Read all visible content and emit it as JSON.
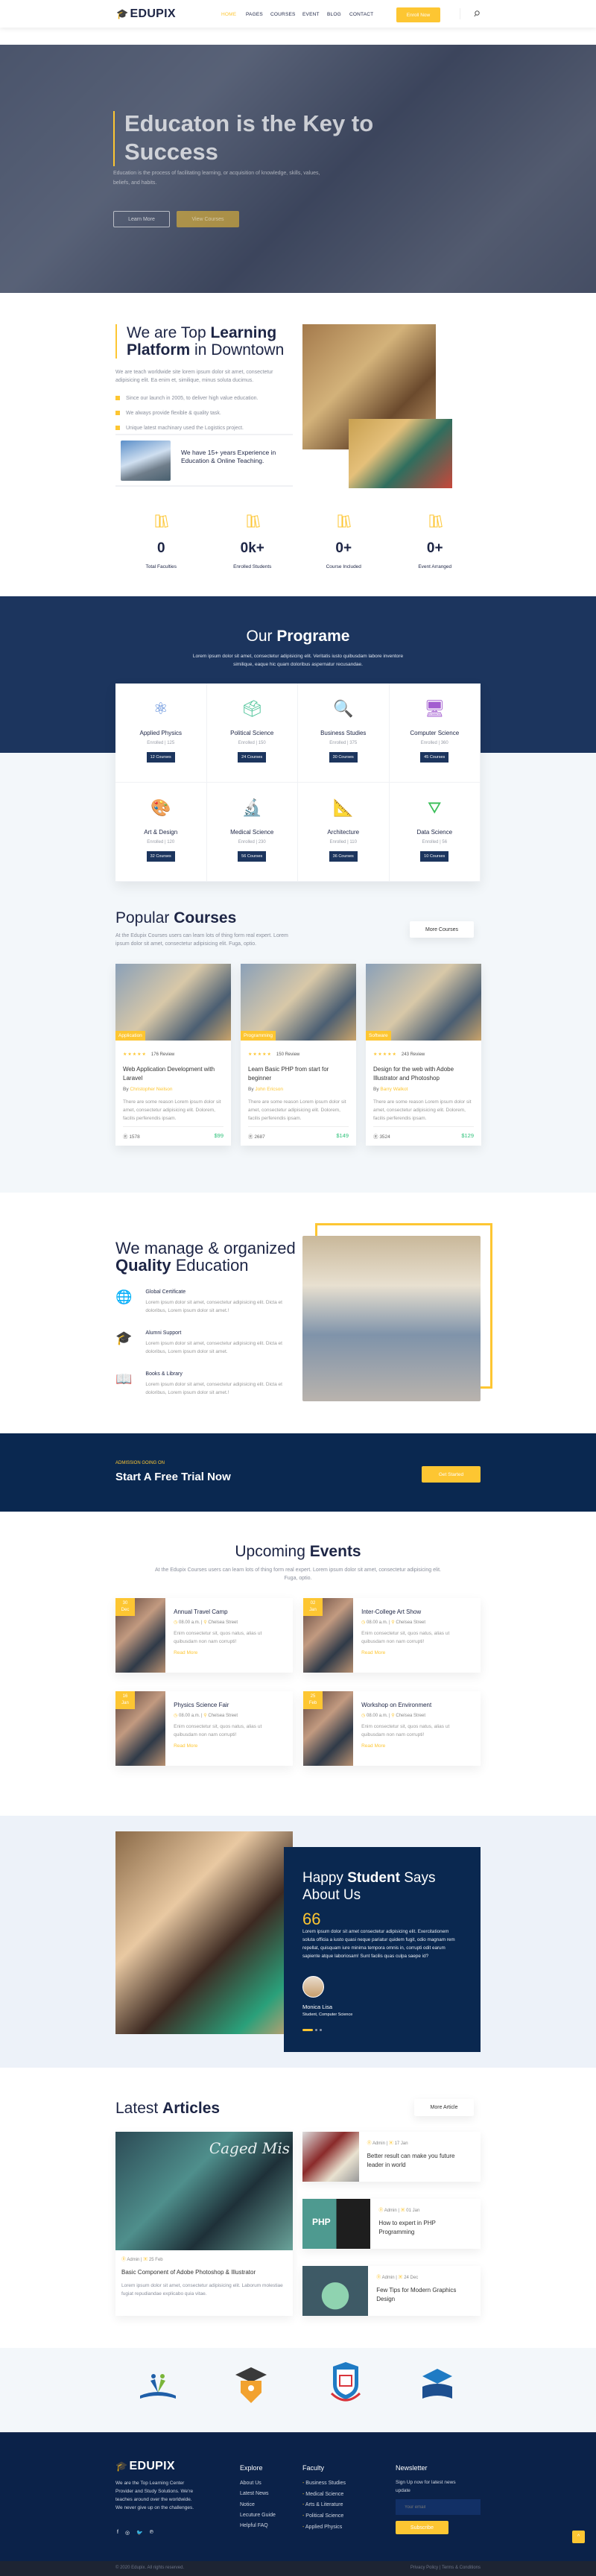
{
  "colors": {
    "accent": "#fdc632",
    "navy": "#1c355e",
    "dark_navy": "#0a2850",
    "price": "#2fc27b"
  },
  "header": {
    "logo": "EDUPIX",
    "nav": [
      {
        "label": "HOME",
        "active": true
      },
      {
        "label": "PAGES"
      },
      {
        "label": "COURSES"
      },
      {
        "label": "EVENT"
      },
      {
        "label": "BLOG"
      },
      {
        "label": "CONTACT"
      }
    ],
    "cta": "Enroll Now",
    "search_icon": "search-icon"
  },
  "hero": {
    "title": "Educaton is the Key to Success",
    "subtitle": "Education is the process of facilitating learning, or acquisition of knowledge, skills, values, beliefs, and habits.",
    "learn_more": "Learn More",
    "view_courses": "View Courses"
  },
  "about": {
    "title_pre": "We are Top ",
    "title_bold1": "Learning",
    "title_bold2": "Platform",
    "title_post": " in Downtown",
    "text": "We are teach worldwide site lorem ipsum dolor sit amet, consectetur adipisicing elit. Ea enim et, similique, minus soluta ducimus.",
    "bullets": [
      "Since our launch in 2005, to deliver high value education.",
      "We always provide flexible & quality task.",
      "Unique latest machinary used the Logistics project."
    ],
    "experience": "We have 15+ years Experience in Education & Online Teaching."
  },
  "stats": [
    {
      "icon": "books-icon",
      "value": "0",
      "label": "Total Faculties"
    },
    {
      "icon": "student-icon",
      "value": "0k+",
      "label": "Enrolled Students"
    },
    {
      "icon": "presentation-icon",
      "value": "0+",
      "label": "Course Included"
    },
    {
      "icon": "clipboard-icon",
      "value": "0+",
      "label": "Event Arranged"
    }
  ],
  "programs": {
    "title_pre": "Our ",
    "title_bold": "Programe",
    "text": "Lorem ipsum dolor sit amet, consectetur adipisicing elit. Veritatis iusto quibusdam labore inventore similique, eaque hic quam doloribus aspernatur recusandae.",
    "items": [
      {
        "icon": "⚛",
        "color": "#4a7fd6",
        "name": "Applied Physics",
        "enrolled": "Enrolled | 125",
        "courses": "12 Courses"
      },
      {
        "icon": "🗳",
        "color": "#4fc49a",
        "name": "Political Science",
        "enrolled": "Enrolled | 150",
        "courses": "24 Courses"
      },
      {
        "icon": "🔍",
        "color": "#e8625c",
        "name": "Business Studies",
        "enrolled": "Enrolled | 375",
        "courses": "30 Courses"
      },
      {
        "icon": "🖥",
        "color": "#a35ed0",
        "name": "Computer Science",
        "enrolled": "Enrolled | 360",
        "courses": "45 Courses"
      },
      {
        "icon": "🎨",
        "color": "#f5b93a",
        "name": "Art & Design",
        "enrolled": "Enrolled | 120",
        "courses": "32 Courses"
      },
      {
        "icon": "🔬",
        "color": "#3cc7d6",
        "name": "Medical Science",
        "enrolled": "Enrolled | 230",
        "courses": "56 Courses"
      },
      {
        "icon": "📐",
        "color": "#f0a53a",
        "name": "Architecture",
        "enrolled": "Enrolled | 110",
        "courses": "36 Courses"
      },
      {
        "icon": "⛛",
        "color": "#3bbf5a",
        "name": "Data Science",
        "enrolled": "Enrolled | 56",
        "courses": "10 Courses"
      }
    ]
  },
  "courses": {
    "title_pre": "Popular ",
    "title_bold": "Courses",
    "text": "At the Edupix Courses users can learn lots of thing form real expert. Lorem ipsum dolor sit amet, consectetur adipisicing elit. Fuga, optio.",
    "more": "More Courses",
    "items": [
      {
        "tag": "Application",
        "rating": 5,
        "reviews": "176 Review",
        "title": "Web Application Development with Laravel",
        "by": "By ",
        "author": "Christopher Neilson",
        "desc": "There are some reason Lorem ipsum dolor sit amet, consectetur adipisicing elit. Dolorem, facilis perferendis ipsam.",
        "students": "1578",
        "price": "$99"
      },
      {
        "tag": "Programming",
        "rating": 5,
        "reviews": "150 Review",
        "title": "Learn Basic PHP from start for beginner",
        "by": "By ",
        "author": "John Ericson",
        "desc": "There are some reason Lorem ipsum dolor sit amet, consectetur adipisicing elit. Dolorem, facilis perferendis ipsam.",
        "students": "2687",
        "price": "$149"
      },
      {
        "tag": "Software",
        "rating": 5,
        "reviews": "243 Review",
        "title": "Design for the web with Adobe Illustrator and Photoshop",
        "by": "By ",
        "author": "Barry Walkot",
        "desc": "There are some reason Lorem ipsum dolor sit amet, consectetur adipisicing elit. Dolorem, facilis perferendis ipsam.",
        "students": "3524",
        "price": "$129"
      }
    ]
  },
  "quality": {
    "title_line1": "We manage & organized",
    "title_bold": "Quality",
    "title_post": " Education",
    "features": [
      {
        "icon": "globe-icon",
        "glyph": "🌐",
        "title": "Global Certificate",
        "text": "Lorem ipsum dolor sit amet, consectetur adipisicing elit. Dicta et doloribus, Lorem ipsum dolor sit amet.!"
      },
      {
        "icon": "graduation-cap-icon",
        "glyph": "🎓",
        "title": "Alumni Support",
        "text": "Lorem ipsum dolor sit amet, consectetur adipisicing elit. Dicta et doloribus, Lorem ipsum dolor sit amet."
      },
      {
        "icon": "book-icon",
        "glyph": "📖",
        "title": "Books & Library",
        "text": "Lorem ipsum dolor sit amet, consectetur adipisicing elit. Dicta et doloribus, Lorem ipsum dolor sit amet.!"
      }
    ]
  },
  "cta": {
    "kicker": "ADMISSION GOING ON",
    "title": "Start A Free Trial Now",
    "button": "Get Started"
  },
  "events": {
    "title_pre": "Upcoming ",
    "title_bold": "Events",
    "text": "At the Edupix Courses users can learn lots of thing form real expert. Lorem ipsum dolor sit amet, consectetur adipisicing elit. Fuga, optio.",
    "items": [
      {
        "day": "30",
        "month": "Dec",
        "title": "Annual Travel Camp",
        "time": "08.00 a.m.",
        "place": "Chelsea Street",
        "desc": "Enim consectetur sit, quos natus, alias ut quibusdam non nam corrupti!",
        "link": "Read More"
      },
      {
        "day": "02",
        "month": "Jan",
        "title": "Inter-College Art Show",
        "time": "08.00 a.m.",
        "place": "Chelsea Street",
        "desc": "Enim consectetur sit, quos natus, alias ut quibusdam non nam corrupti!",
        "link": "Read More"
      },
      {
        "day": "16",
        "month": "Jan",
        "title": "Physics Science Fair",
        "time": "08.00 a.m.",
        "place": "Chelsea Street",
        "desc": "Enim consectetur sit, quos natus, alias ut quibusdam non nam corrupti!",
        "link": "Read More"
      },
      {
        "day": "25",
        "month": "Feb",
        "title": "Workshop on Environment",
        "time": "08.00 a.m.",
        "place": "Chelsea Street",
        "desc": "Enim consectetur sit, quos natus, alias ut quibusdam non nam corrupti!",
        "link": "Read More"
      }
    ]
  },
  "testimonial": {
    "title_pre": "Happy ",
    "title_bold": "Student",
    "title_post": " Says About Us",
    "quote": "Lorem ipsum dolor sit amet consectetur adipisicing elit. Exercitationem soluta officia a iusto quasi neque pariatur quidem fugit, odio magnam rem repellat, quisquam iure minima tempora omnis in, corrupti odit earum sapiente atque laboriosam! Sunt facilis quas culpa saepe id?",
    "name": "Monica Lisa",
    "role": "Student, Computer Science",
    "active_slide": 1,
    "slides": 3
  },
  "articles": {
    "title_pre": "Latest ",
    "title_bold": "Articles",
    "more": "More Article",
    "featured": {
      "author": "Admin",
      "date": "25 Feb",
      "title": "Basic Component of Adobe Photoshop & Illustrator",
      "text": "Lorem ipsum dolor sit amet, consectetur adipisicing elit. Laborum molestiae fugiat repudiandae explicabo quia vitae.",
      "image_text": "Caged Mis"
    },
    "items": [
      {
        "author": "Admin",
        "date": "17 Jan",
        "title": "Better result can make you future leader in world"
      },
      {
        "author": "Admin",
        "date": "01 Jan",
        "title": "How to expert in PHP Programming",
        "image_text": "PHP"
      },
      {
        "author": "Admin",
        "date": "24 Dec",
        "title": "Few Tips for Modern Graphics Design"
      }
    ]
  },
  "partners": [
    "partner-logo-reading",
    "partner-logo-graduate",
    "partner-logo-shield",
    "partner-logo-book"
  ],
  "footer": {
    "logo": "EDUPIX",
    "about": "We are the Top Learning Center Provider and Study Solutions. We're teaches around over the worldwide. We never give up on the challenges.",
    "social": [
      "facebook-icon",
      "instagram-icon",
      "twitter-icon",
      "pinterest-icon"
    ],
    "explore_title": "Explore",
    "explore": [
      "About Us",
      "Latest News",
      "Notice",
      "Lecuture Guide",
      "Helpful FAQ"
    ],
    "faculty_title": "Faculty",
    "faculty": [
      "Business Studies",
      "Medical Science",
      "Arts & Literature",
      "Political Science",
      "Applied Physics"
    ],
    "newsletter_title": "Newsletter",
    "newsletter_text": "Sign Up now for latest news update",
    "email_placeholder": "Your email",
    "subscribe": "Subscribe",
    "copyright": "© 2020 Edupix. All rights reserved.",
    "legal": "Privacy Policy | Terms & Conditions"
  }
}
